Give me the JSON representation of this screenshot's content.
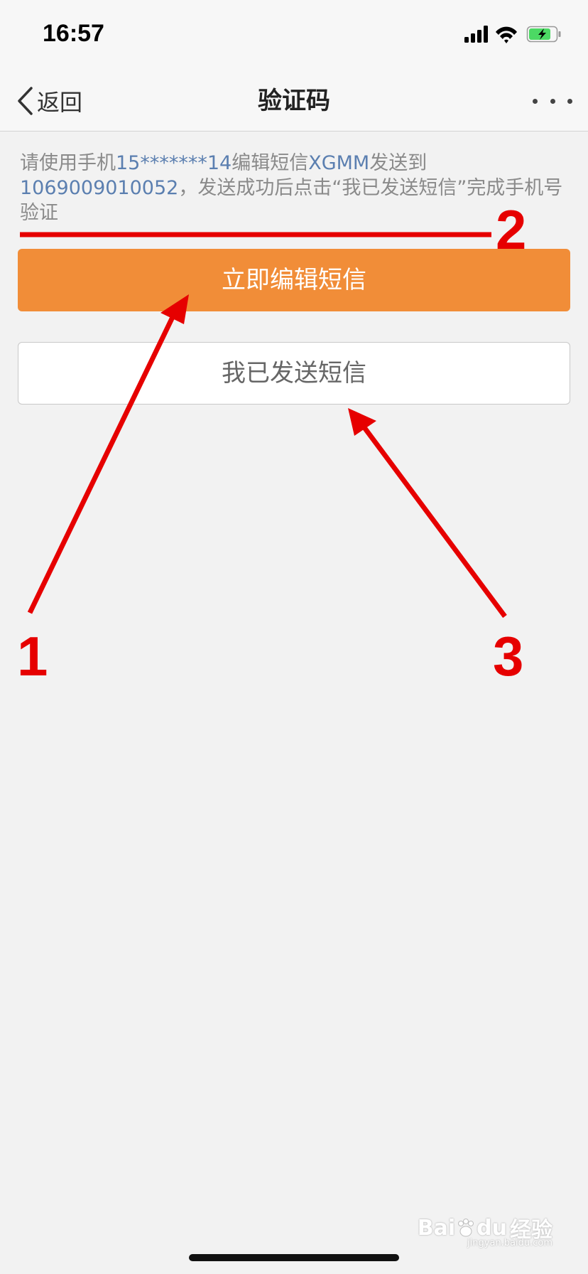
{
  "status_bar": {
    "time": "16:57",
    "icons": [
      "cellular-signal-icon",
      "wifi-icon",
      "battery-charging-icon"
    ],
    "battery_color": "#4cd964"
  },
  "nav": {
    "back_label": "返回",
    "title": "验证码",
    "more_icon": "more-icon"
  },
  "instruction": {
    "part1": "请使用手机",
    "phone": "15*******14",
    "part2": "编辑短信",
    "code": "XGMM",
    "part3": "发送到",
    "number": "1069009010052",
    "part4": "，发送成功后点击“我已发送短信”完成手机号验证"
  },
  "buttons": {
    "edit_sms": "立即编辑短信",
    "sent_sms": "我已发送短信"
  },
  "colors": {
    "primary": "#f18d38",
    "link_text": "#5b7fb0",
    "annotation": "#e60000",
    "background": "#f2f2f2"
  },
  "annotations": {
    "label_1": "1",
    "label_2": "2",
    "label_3": "3"
  },
  "watermark": {
    "brand": "Bai",
    "brand2": "du",
    "suffix": "经验",
    "sub": "jingyan.baidu.com"
  }
}
